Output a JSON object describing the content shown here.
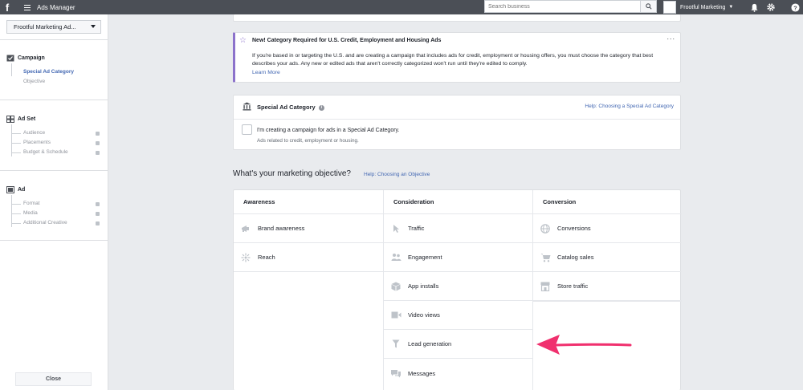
{
  "topbar": {
    "logo": "f",
    "title": "Ads Manager",
    "search_placeholder": "Search business",
    "account_name": "Frootful Marketing"
  },
  "sidebar": {
    "account_select": "Frootful Marketing Ad...",
    "campaign": {
      "label": "Campaign",
      "items": [
        "Special Ad Category",
        "Objective"
      ]
    },
    "adset": {
      "label": "Ad Set",
      "items": [
        "Audience",
        "Placements",
        "Budget & Schedule"
      ]
    },
    "ad": {
      "label": "Ad",
      "items": [
        "Format",
        "Media",
        "Additional Creative"
      ]
    },
    "close_label": "Close"
  },
  "notice": {
    "title": "New! Category Required for U.S. Credit, Employment and Housing Ads",
    "body": "If you're based in or targeting the U.S. and are creating a campaign that includes ads for credit, employment or housing offers, you must choose the category that best describes your ads. Any new or edited ads that aren't correctly categorized won't run until they're edited to comply.",
    "link": "Learn More",
    "menu": "..."
  },
  "special": {
    "title": "Special Ad Category",
    "info": "i",
    "help": "Help: Choosing a Special Ad Category",
    "check_label": "I'm creating a campaign for ads in a Special Ad Category.",
    "check_sub": "Ads related to credit, employment or housing."
  },
  "objective": {
    "title": "What's your marketing objective?",
    "help": "Help: Choosing an Objective",
    "columns": [
      {
        "header": "Awareness",
        "items": [
          {
            "label": "Brand awareness",
            "icon": "megaphone-icon"
          },
          {
            "label": "Reach",
            "icon": "reach-icon"
          }
        ]
      },
      {
        "header": "Consideration",
        "items": [
          {
            "label": "Traffic",
            "icon": "cursor-icon"
          },
          {
            "label": "Engagement",
            "icon": "people-icon"
          },
          {
            "label": "App installs",
            "icon": "box-icon"
          },
          {
            "label": "Video views",
            "icon": "video-icon"
          },
          {
            "label": "Lead generation",
            "icon": "funnel-icon"
          },
          {
            "label": "Messages",
            "icon": "chat-icon"
          }
        ]
      },
      {
        "header": "Conversion",
        "items": [
          {
            "label": "Conversions",
            "icon": "globe-icon"
          },
          {
            "label": "Catalog sales",
            "icon": "cart-icon"
          },
          {
            "label": "Store traffic",
            "icon": "store-icon"
          }
        ]
      }
    ]
  },
  "colors": {
    "topbar": "#4b4f56",
    "link": "#4267b2",
    "notice_accent": "#8c72cb",
    "arrow": "#f0306e"
  }
}
